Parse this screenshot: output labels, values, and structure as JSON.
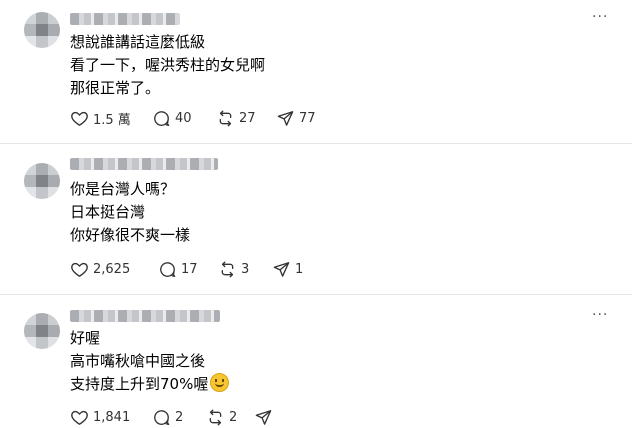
{
  "posts": [
    {
      "lines": [
        "想說誰講話這麼低級",
        "看了一下，喔洪秀柱的女兒啊",
        "那很正常了。"
      ],
      "likes": "1.5 萬",
      "replies": "40",
      "reposts": "27",
      "shares": "77"
    },
    {
      "lines": [
        "你是台灣人嗎？",
        "日本挺台灣",
        "你好像很不爽一樣"
      ],
      "likes": "2,625",
      "replies": "17",
      "reposts": "3",
      "shares": "1"
    },
    {
      "lines": [
        "好喔",
        "高市嘴秋嗆中國之後",
        "支持度上升到70%喔"
      ],
      "likes": "1,841",
      "replies": "2",
      "reposts": "2",
      "shares": ""
    }
  ],
  "icons": {
    "like": "heart-icon",
    "reply": "comment-icon",
    "repost": "repost-icon",
    "share": "send-icon",
    "more": "more-icon",
    "emoji": "smiling-face-icon"
  }
}
